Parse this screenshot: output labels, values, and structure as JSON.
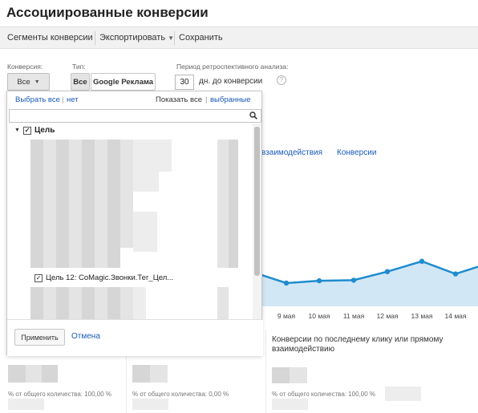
{
  "page": {
    "title": "Ассоциированные конверсии"
  },
  "toolbar": {
    "segments_label": "Сегменты конверсии",
    "export_label": "Экспортировать",
    "save_label": "Сохранить"
  },
  "filters": {
    "conversion_label": "Конверсия:",
    "conversion_value": "Все",
    "type_label": "Тип:",
    "type_options": [
      "Все",
      "Google Реклама"
    ],
    "lookback_label": "Период ретроспективного анализа:",
    "lookback_days": "30",
    "lookback_suffix": "дн. до конверсии",
    "help_glyph": "?"
  },
  "dropdown": {
    "select_all": "Выбрать все",
    "separator": "|",
    "none": "нет",
    "show_all": "Показать все",
    "selected": "выбранные",
    "search_placeholder": "",
    "group_label": "Цель",
    "goal_item_label": "Цель 12: CoMagic.Звонки.Тег_Цел...",
    "apply_label": "Применить",
    "cancel_label": "Отмена"
  },
  "report": {
    "tabs": [
      "взаимодействия",
      "Конверсии"
    ],
    "panel_title": "Конверсии по последнему клику или прямому взаимодействию",
    "pct_labels": [
      "% от общего количества: 100,00 %",
      "% от общего количества: 0,00 %",
      "% от общего количества: 100,00 %"
    ]
  },
  "chart_data": {
    "type": "line",
    "x": [
      "9 мая",
      "10 мая",
      "11 мая",
      "12 мая",
      "13 мая",
      "14 мая"
    ],
    "series": [
      {
        "values": [
          40,
          42,
          42.5,
          50,
          59,
          48
        ]
      }
    ],
    "color": "#1f8ccf"
  },
  "colors": {
    "link": "#1a5bb8",
    "line": "#1f8ccf",
    "area": "#d2e7f5"
  }
}
